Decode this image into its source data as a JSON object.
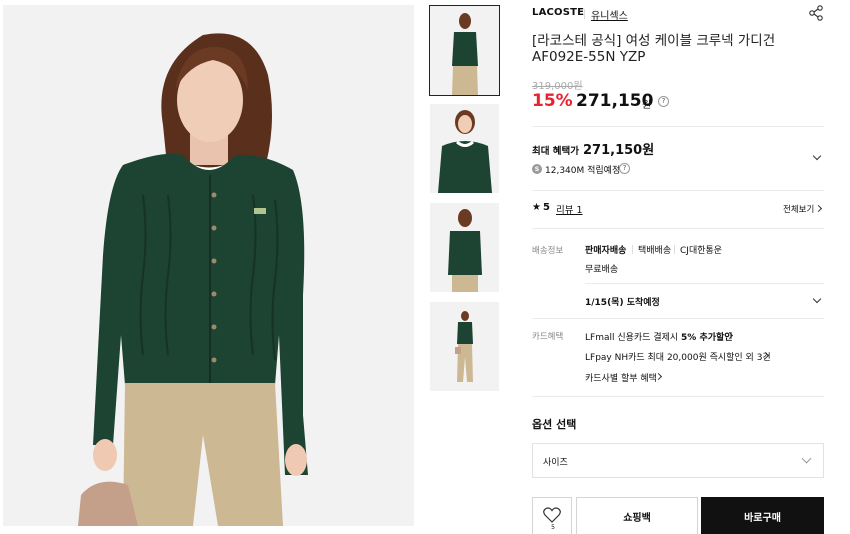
{
  "product": {
    "brand": "LACOSTE",
    "gender_tag": "유니섹스",
    "title_line1": "[라코스테 공식] 여성 케이블 크루넥 가디건",
    "title_line2": "AF092E-55N YZP",
    "original_price": "319,000원",
    "discount": "15%",
    "price": "271,150",
    "price_unit": "원"
  },
  "benefit": {
    "label": "최대 혜택가",
    "price": "271,150원",
    "points": "12,340M 적립예정",
    "points_icon": "S"
  },
  "review": {
    "star": "★",
    "rating": "5",
    "link": "리뷰 1",
    "view_all": "전체보기"
  },
  "shipping": {
    "label": "배송정보",
    "seller": "판매자배송",
    "method": "택배배송",
    "carrier": "CJ대한통운",
    "fee": "무료배송",
    "arrival": "1/15(목) 도착예정"
  },
  "card": {
    "label": "카드혜택",
    "line1_prefix": "LFmall 신용카드 결제시 ",
    "line1_bold": "5% 추가할인",
    "line2": "LFpay NH카드 최대 20,000원 즉시할인 외 3건",
    "line3": "카드사별 할부 혜택"
  },
  "options": {
    "title": "옵션 선택",
    "size_placeholder": "사이즈"
  },
  "actions": {
    "like_count": "5",
    "cart": "쇼핑백",
    "buy": "바로구매"
  },
  "colors": {
    "sale_red": "#e6232f",
    "buy_black": "#111111",
    "cardigan_green": "#1d4332",
    "pants_khaki": "#cdb894"
  }
}
